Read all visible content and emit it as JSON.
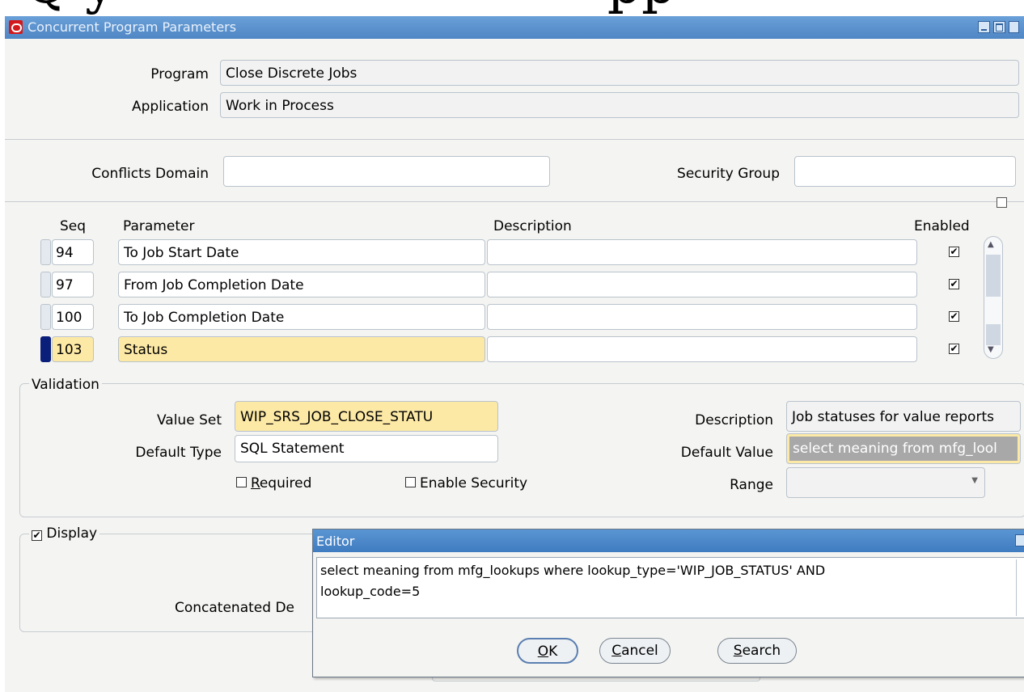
{
  "window": {
    "title": "Concurrent Program Parameters"
  },
  "header": {
    "program_label": "Program",
    "program_value": "Close Discrete Jobs",
    "application_label": "Application",
    "application_value": "Work in Process",
    "conflicts_label": "Conflicts Domain",
    "conflicts_value": "",
    "security_label": "Security Group",
    "security_value": ""
  },
  "table": {
    "columns": {
      "seq": "Seq",
      "parameter": "Parameter",
      "description": "Description",
      "enabled": "Enabled"
    },
    "rows": [
      {
        "seq": "94",
        "parameter": "To Job Start Date",
        "description": "",
        "enabled": true
      },
      {
        "seq": "97",
        "parameter": "From Job Completion Date",
        "description": "",
        "enabled": true
      },
      {
        "seq": "100",
        "parameter": "To Job Completion Date",
        "description": "",
        "enabled": true
      },
      {
        "seq": "103",
        "parameter": "Status",
        "description": "",
        "enabled": true
      }
    ],
    "selected_row": 3
  },
  "validation": {
    "title": "Validation",
    "value_set_label": "Value Set",
    "value_set_value": "WIP_SRS_JOB_CLOSE_STATU",
    "default_type_label": "Default Type",
    "default_type_value": "SQL Statement",
    "required_label": "Required",
    "enable_security_label": "Enable Security",
    "description_label": "Description",
    "description_value": "Job statuses for value reports",
    "default_value_label": "Default Value",
    "default_value_value": "select meaning from mfg_lool",
    "range_label": "Range",
    "range_value": ""
  },
  "display": {
    "title": "Display",
    "checked": true,
    "concatenated_label": "Concatenated De"
  },
  "editor": {
    "title": "Editor",
    "line1": "select meaning from mfg_lookups where lookup_type='WIP_JOB_STATUS' AND",
    "line2": "lookup_code=5",
    "ok_label": "OK",
    "cancel_label": "Cancel",
    "search_label": "Search"
  },
  "colors": {
    "titlebar": "#5a8fcb",
    "selected_field": "#fde9a6",
    "row_indicator": "#0a1f7a"
  },
  "icons": {
    "app": "oracle-logo-icon",
    "check": "checkmark-icon"
  }
}
